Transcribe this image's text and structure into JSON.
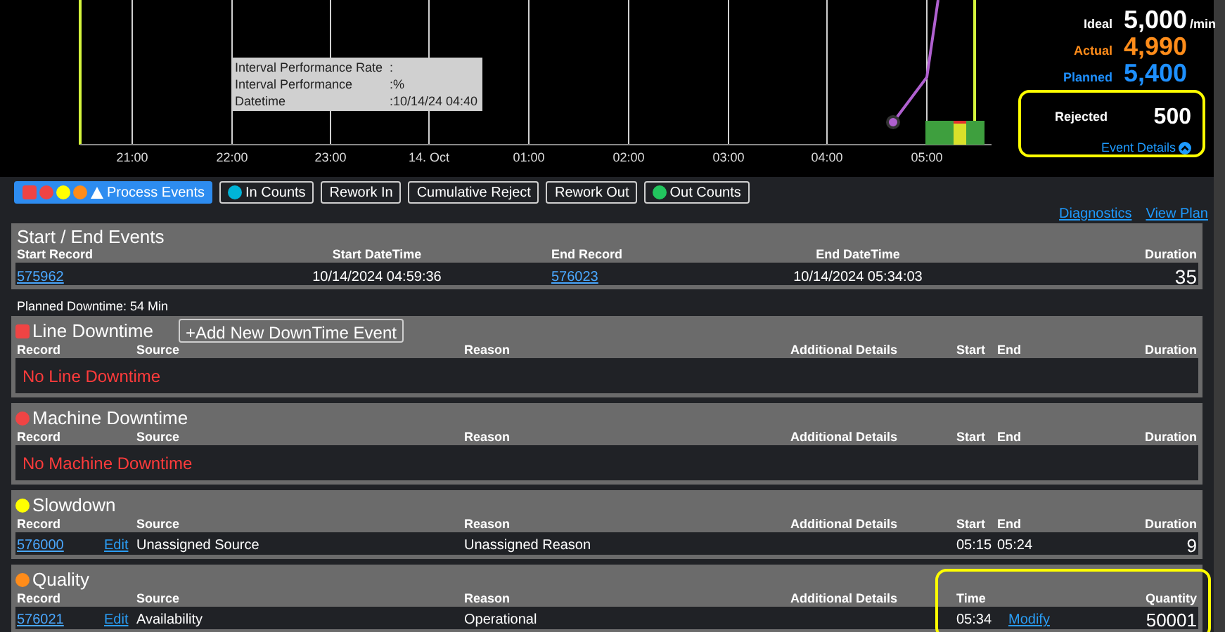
{
  "chart": {
    "x_labels": [
      "21:00",
      "22:00",
      "23:00",
      "14. Oct",
      "01:00",
      "02:00",
      "03:00",
      "04:00",
      "05:00"
    ],
    "tooltip": [
      {
        "label": "Interval Performance Rate",
        "value": ":"
      },
      {
        "label": "Interval Performance",
        "value": ":%"
      },
      {
        "label": "Datetime",
        "value": ":10/14/24 04:40"
      }
    ]
  },
  "stats": [
    {
      "label": "Ideal",
      "value": "5,000",
      "unit": "/min",
      "color": "#ffffff"
    },
    {
      "label": "Actual",
      "value": "4,990",
      "color": "#ff8c1a"
    },
    {
      "label": "Planned",
      "value": "5,400",
      "color": "#1e90ff"
    }
  ],
  "rejected": {
    "label": "Rejected",
    "value": "500",
    "link": "Event Details"
  },
  "filters": [
    {
      "label": "Process Events",
      "selected": true,
      "markers": [
        {
          "kind": "square",
          "color": "#ef4444"
        },
        {
          "kind": "circle",
          "color": "#ef4444"
        },
        {
          "kind": "circle",
          "color": "#ffff00"
        },
        {
          "kind": "circle",
          "color": "#ff8c1a"
        },
        {
          "kind": "triangle",
          "color": "#ffffff"
        }
      ]
    },
    {
      "label": "In Counts",
      "selected": false,
      "markers": [
        {
          "kind": "circle",
          "color": "#00b4d8"
        }
      ]
    },
    {
      "label": "Rework In",
      "selected": false
    },
    {
      "label": "Cumulative Reject",
      "selected": false
    },
    {
      "label": "Rework Out",
      "selected": false
    },
    {
      "label": "Out Counts",
      "selected": false,
      "markers": [
        {
          "kind": "circle",
          "color": "#22c55e"
        }
      ]
    }
  ],
  "links": [
    "Diagnostics",
    "View Plan"
  ],
  "start_end": {
    "title": "Start / End Events",
    "columns": [
      "Start Record",
      "Start DateTime",
      "End Record",
      "End DateTime",
      "Duration"
    ],
    "row": {
      "start_record": "575962",
      "start_datetime": "10/14/2024 04:59:36",
      "end_record": "576023",
      "end_datetime": "10/14/2024 05:34:03",
      "duration": "35"
    }
  },
  "planned_downtime": "Planned Downtime: 54 Min",
  "sections": [
    {
      "kind": "downtime",
      "title": "Line Downtime",
      "marker": {
        "kind": "square",
        "color": "#ef4444"
      },
      "add_button": "+Add New DownTime Event",
      "columns": [
        "Record",
        "Source",
        "Reason",
        "Additional Details",
        "Start",
        "End",
        "Duration"
      ],
      "empty_message": "No Line Downtime"
    },
    {
      "kind": "downtime",
      "title": "Machine Downtime",
      "marker": {
        "kind": "circle",
        "color": "#ef4444"
      },
      "columns": [
        "Record",
        "Source",
        "Reason",
        "Additional Details",
        "Start",
        "End",
        "Duration"
      ],
      "empty_message": "No Machine Downtime"
    },
    {
      "kind": "downtime",
      "title": "Slowdown",
      "marker": {
        "kind": "circle",
        "color": "#ffff00"
      },
      "columns": [
        "Record",
        "Source",
        "Reason",
        "Additional Details",
        "Start",
        "End",
        "Duration"
      ],
      "rows": [
        {
          "record": "576000",
          "edit": "Edit",
          "source": "Unassigned Source",
          "reason": "Unassigned Reason",
          "start": "05:15",
          "end": "05:24",
          "duration": "9"
        }
      ]
    },
    {
      "kind": "quality",
      "title": "Quality",
      "marker": {
        "kind": "circle",
        "color": "#ff8c1a"
      },
      "highlighted": true,
      "columns": [
        "Record",
        "Source",
        "Reason",
        "Additional Details",
        "Time",
        "Quantity"
      ],
      "rows": [
        {
          "record": "576021",
          "edit": "Edit",
          "source": "Availability",
          "reason": "Operational",
          "time": "05:34",
          "action": "Modify",
          "quantity": "50001"
        }
      ]
    }
  ]
}
